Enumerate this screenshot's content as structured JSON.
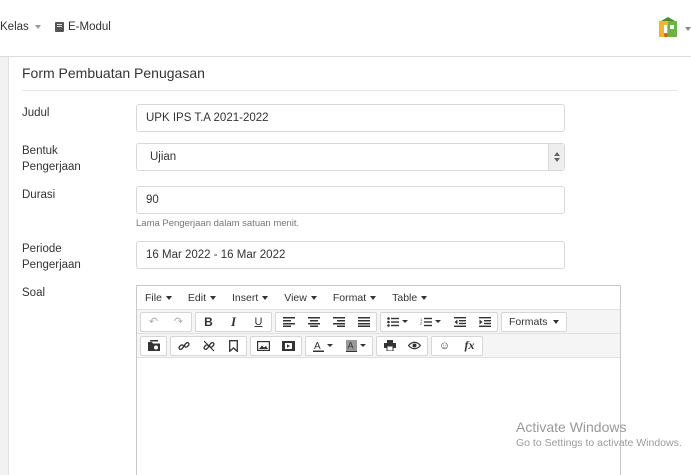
{
  "nav": {
    "kelas": "Kelas",
    "emodul": "E-Modul"
  },
  "form": {
    "title": "Form Pembuatan Penugasan",
    "judul": {
      "label": "Judul",
      "value": "UPK IPS T.A 2021-2022"
    },
    "bentuk": {
      "label_line1": "Bentuk",
      "label_line2": "Pengerjaan",
      "value": "Ujian"
    },
    "durasi": {
      "label": "Durasi",
      "value": "90",
      "help": "Lama Pengerjaan dalam satuan menit."
    },
    "periode": {
      "label_line1": "Periode",
      "label_line2": "Pengerjaan",
      "value": "16 Mar 2022 - 16 Mar 2022"
    },
    "soal": {
      "label": "Soal"
    }
  },
  "editor": {
    "menus": [
      "File",
      "Edit",
      "Insert",
      "View",
      "Format",
      "Table"
    ],
    "formats_label": "Formats",
    "icons": {
      "undo": "↶",
      "redo": "↷",
      "bold": "B",
      "italic": "I",
      "underline": "U",
      "fx": "fx",
      "emoticon": "☺"
    }
  },
  "watermark": {
    "title": "Activate Windows",
    "subtitle": "Go to Settings to activate Windows."
  },
  "colors": {
    "accent": "#333333",
    "border": "#d8d8d8",
    "background": "#f2f2f2"
  }
}
